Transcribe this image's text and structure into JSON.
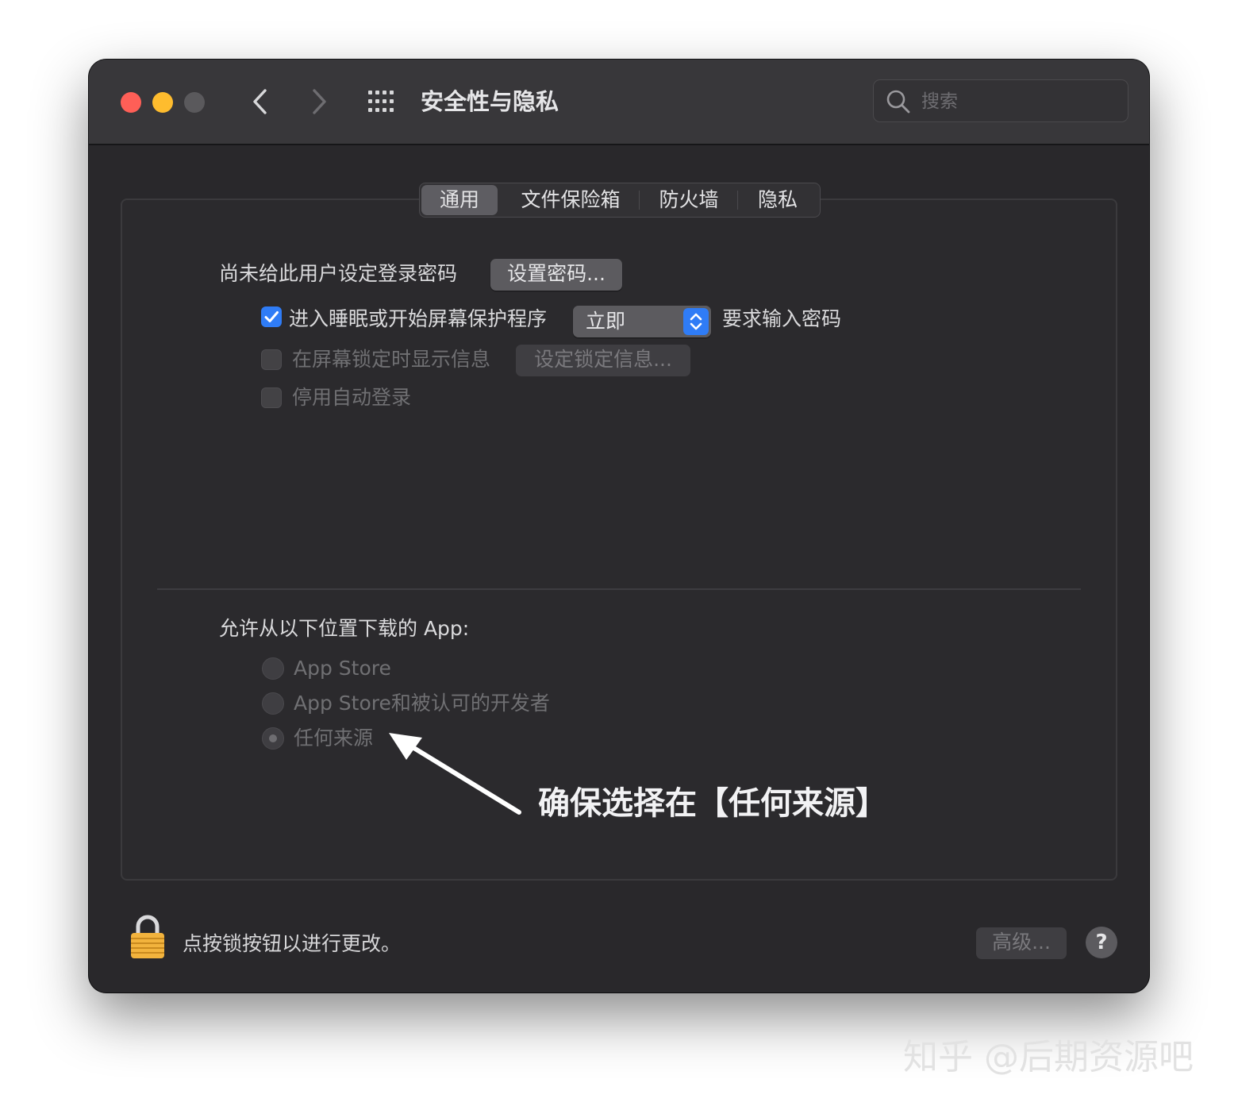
{
  "window": {
    "title": "安全性与隐私",
    "search_placeholder": "搜索"
  },
  "tabs": [
    {
      "label": "通用",
      "active": true
    },
    {
      "label": "文件保险箱",
      "active": false
    },
    {
      "label": "防火墙",
      "active": false
    },
    {
      "label": "隐私",
      "active": false
    }
  ],
  "general": {
    "password_notice": "尚未给此用户设定登录密码",
    "set_password_button": "设置密码...",
    "require_password": {
      "checked": true,
      "label_before": "进入睡眠或开始屏幕保护程序",
      "select_value": "立即",
      "label_after": "要求输入密码"
    },
    "show_message": {
      "checked": false,
      "label": "在屏幕锁定时显示信息",
      "button": "设定锁定信息..."
    },
    "disable_autologin": {
      "checked": false,
      "label": "停用自动登录"
    }
  },
  "downloads": {
    "heading": "允许从以下位置下载的 App:",
    "options": [
      {
        "label": "App Store",
        "selected": false
      },
      {
        "label": "App Store和被认可的开发者",
        "selected": false
      },
      {
        "label": "任何来源",
        "selected": true
      }
    ]
  },
  "annotation": "确保选择在【任何来源】",
  "footer": {
    "lock_text": "点按锁按钮以进行更改。",
    "advanced_button": "高级...",
    "help_label": "?"
  },
  "watermark": "知乎 @后期资源吧",
  "colors": {
    "window_bg": "#29282b",
    "accent_blue": "#2f7cf6",
    "close_red": "#fe5f57",
    "minimize_yellow": "#febc2e"
  }
}
